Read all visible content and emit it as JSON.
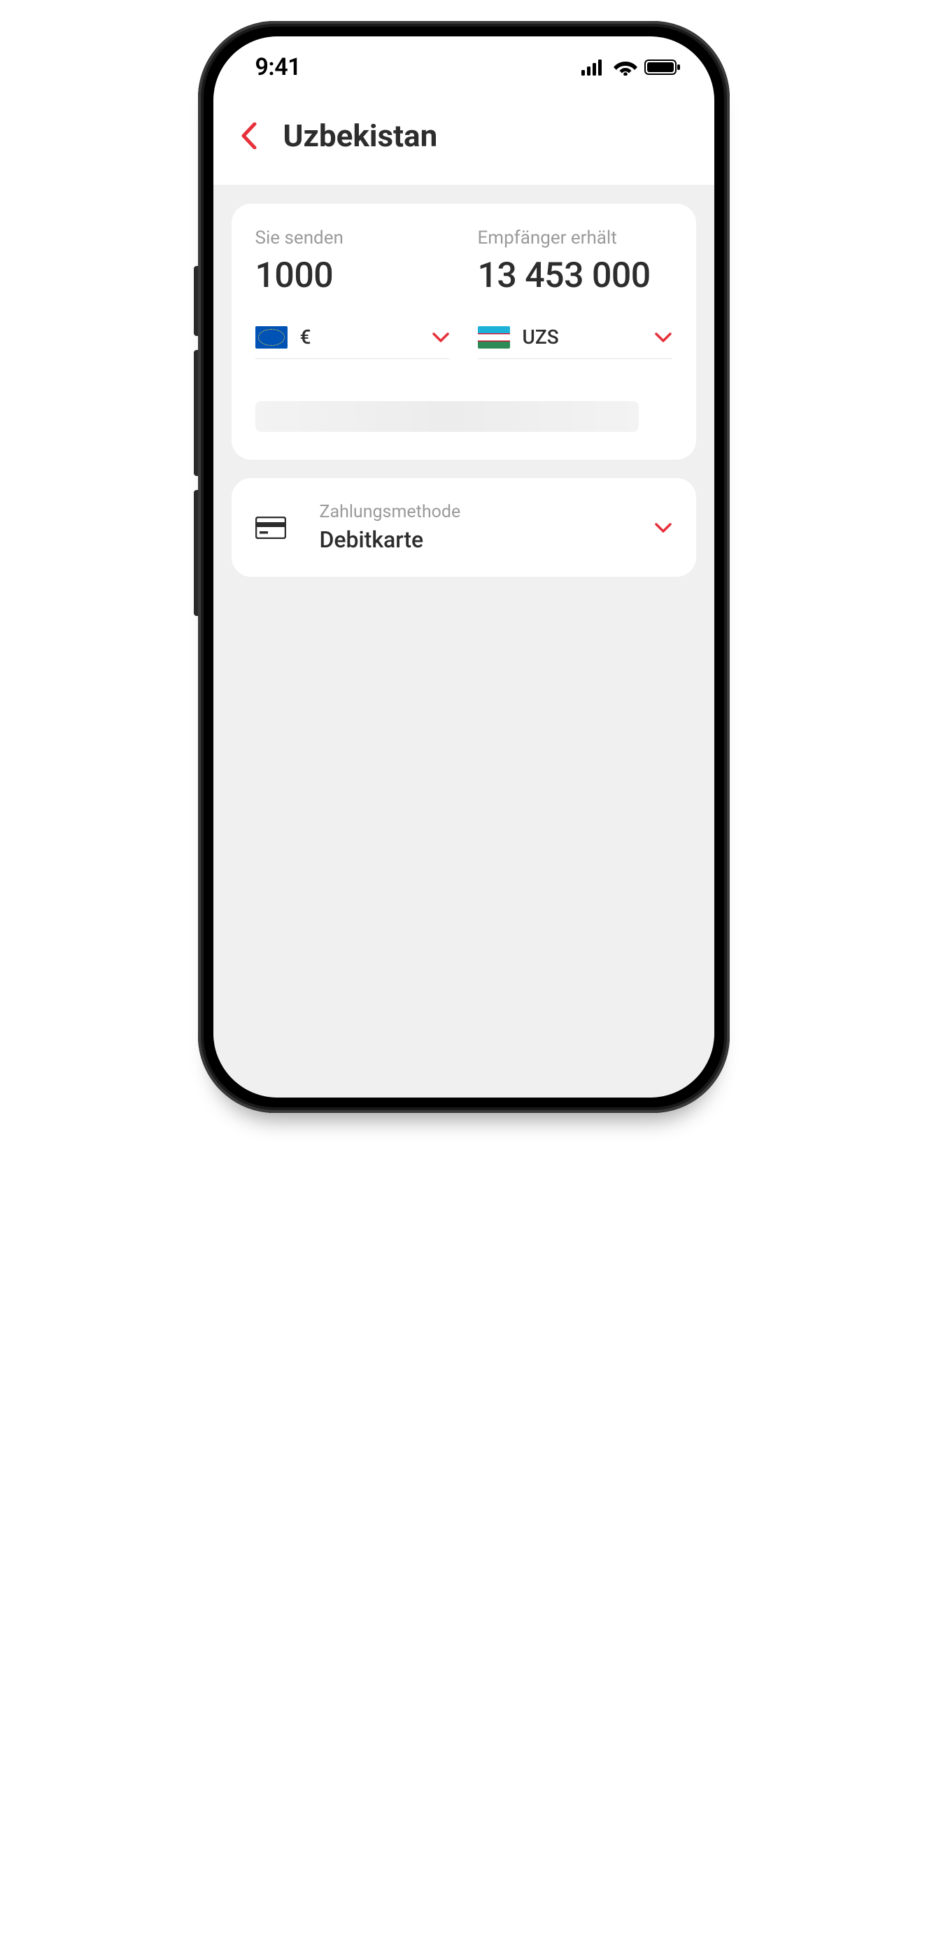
{
  "statusbar": {
    "time": "9:41"
  },
  "header": {
    "title": "Uzbekistan"
  },
  "transfer": {
    "send_label": "Sie senden",
    "send_amount": "1000",
    "receive_label": "Empfänger erhält",
    "receive_amount": "13 453 000",
    "send_currency": {
      "symbol": "€",
      "flag": "eu"
    },
    "receive_currency": {
      "code": "UZS",
      "flag": "uz"
    }
  },
  "payment_method": {
    "label": "Zahlungsmethode",
    "value": "Debitkarte"
  },
  "colors": {
    "accent": "#e6303a",
    "text": "#2d2d2d",
    "muted": "#9a9a9a",
    "bg": "#f0f0f0"
  }
}
